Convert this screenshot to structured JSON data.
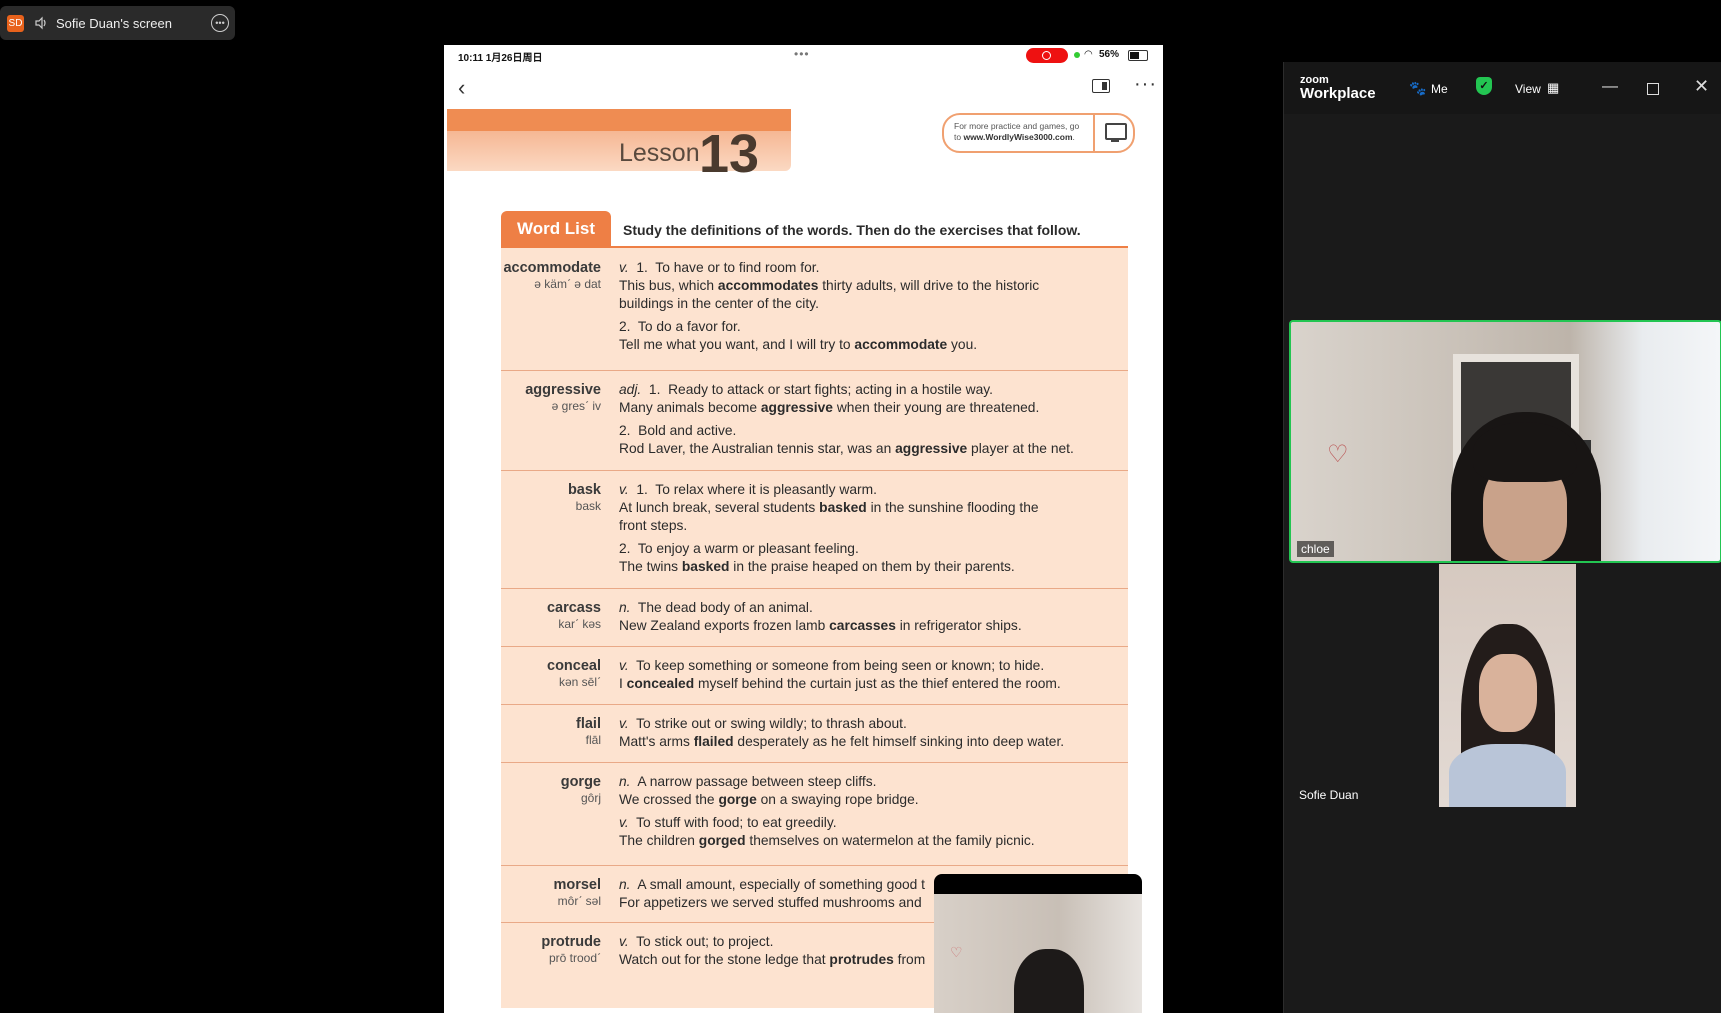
{
  "share": {
    "initials": "SD",
    "label": "Sofie Duan's screen"
  },
  "tablet": {
    "status_time": "10:11  1月26日周日",
    "status_dots": "•••",
    "battery": "56%"
  },
  "page": {
    "lesson_word": "Lesson",
    "lesson_number": "13",
    "promo_line1": "For more practice and games, go",
    "promo_line2_prefix": "to ",
    "promo_url": "www.WordlyWise3000.com",
    "promo_suffix": ".",
    "wordlist_tab": "Word List",
    "instruction": "Study the definitions of the words. Then do the exercises that follow."
  },
  "entries": [
    {
      "word": "accommodate",
      "pron": "ə kämˊ ə dat",
      "lines": [
        [
          "v.",
          "  1.  To have or to find room for."
        ],
        [
          "",
          "This bus, which ",
          "accommodates",
          " thirty adults, will drive to the historic"
        ],
        [
          "",
          "buildings in the center of the city."
        ],
        [
          "",
          "2.  To do a favor for."
        ],
        [
          "",
          "Tell me what you want, and I will try to ",
          "accommodate",
          " you."
        ]
      ]
    },
    {
      "word": "aggressive",
      "pron": "ə gresˊ iv",
      "lines": [
        [
          "adj.",
          "  1.  Ready to attack or start fights; acting in a hostile way."
        ],
        [
          "",
          "Many animals become ",
          "aggressive",
          " when their young are threatened."
        ],
        [
          "",
          "2.  Bold and active."
        ],
        [
          "",
          "Rod Laver, the Australian tennis star, was an ",
          "aggressive",
          " player at the net."
        ]
      ]
    },
    {
      "word": "bask",
      "pron": "bask",
      "lines": [
        [
          "v.",
          "  1.  To relax where it is pleasantly warm."
        ],
        [
          "",
          "At lunch break, several students ",
          "basked",
          " in the sunshine flooding the"
        ],
        [
          "",
          "front steps."
        ],
        [
          "",
          "2.  To enjoy a warm or pleasant feeling."
        ],
        [
          "",
          "The twins ",
          "basked",
          " in the praise heaped on them by their parents."
        ]
      ]
    },
    {
      "word": "carcass",
      "pron": "karˊ kəs",
      "lines": [
        [
          "n.",
          "  The dead body of an animal."
        ],
        [
          "",
          "New Zealand exports frozen lamb ",
          "carcasses",
          " in refrigerator ships."
        ]
      ]
    },
    {
      "word": "conceal",
      "pron": "kən sēlˊ",
      "lines": [
        [
          "v.",
          "  To keep something or someone from being seen or known; to hide."
        ],
        [
          "",
          "I ",
          "concealed",
          " myself behind the curtain just as the thief entered the room."
        ]
      ]
    },
    {
      "word": "flail",
      "pron": "flāl",
      "lines": [
        [
          "v.",
          "  To strike out or swing wildly; to thrash about."
        ],
        [
          "",
          "Matt's arms ",
          "flailed",
          " desperately as he felt himself sinking into deep water."
        ]
      ]
    },
    {
      "word": "gorge",
      "pron": "gôrj",
      "lines": [
        [
          "n.",
          "  A narrow passage between steep cliffs."
        ],
        [
          "",
          "We crossed the ",
          "gorge",
          " on a swaying rope bridge."
        ],
        [
          "v.",
          "  To stuff with food; to eat greedily."
        ],
        [
          "",
          "The children ",
          "gorged",
          " themselves on watermelon at the family picnic."
        ]
      ]
    },
    {
      "word": "morsel",
      "pron": "môrˊ səl",
      "lines": [
        [
          "n.",
          "  A small amount, especially of something good t"
        ],
        [
          "",
          "For appetizers we served stuffed mushrooms and"
        ]
      ]
    },
    {
      "word": "protrude",
      "pron": "prō troodˊ",
      "lines": [
        [
          "v.",
          "  To stick out; to project."
        ],
        [
          "",
          "Watch out for the stone ledge that ",
          "protrudes",
          " from"
        ]
      ]
    }
  ],
  "zoom": {
    "brand_top": "zoom",
    "brand_bottom": "Workplace",
    "apps_label": "Me",
    "view_label": "View",
    "participants": [
      {
        "name": "chloe"
      },
      {
        "name": "Sofie Duan"
      }
    ]
  }
}
